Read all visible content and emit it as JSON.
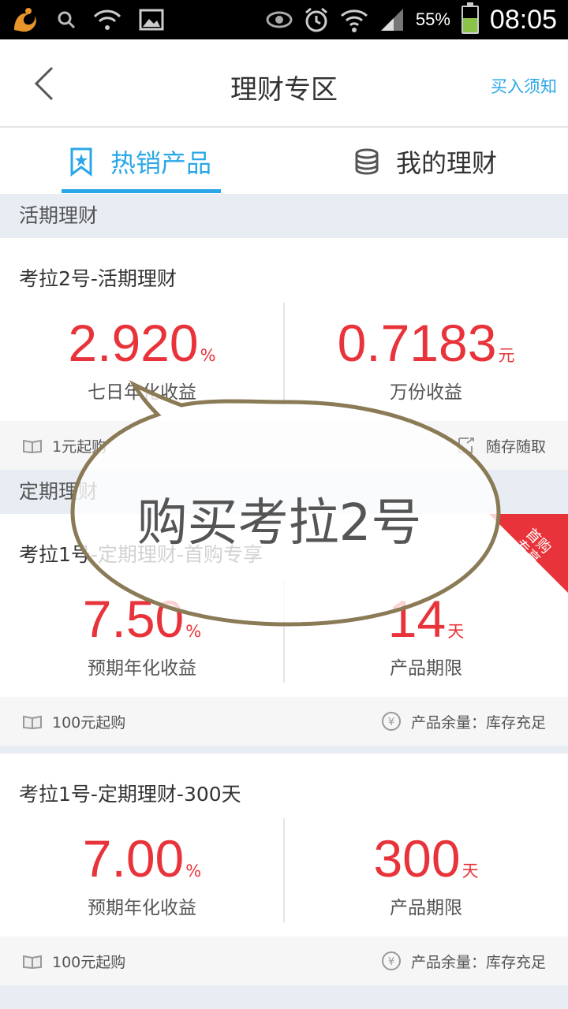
{
  "status_bar": {
    "battery_pct": "55%",
    "battery_level": 0.55,
    "time": "08:05",
    "icons": [
      "uc-browser-icon",
      "search-icon",
      "wifi-question-icon",
      "image-icon",
      "eye-icon",
      "alarm-icon",
      "wifi-icon",
      "signal-icon",
      "battery-icon"
    ]
  },
  "header": {
    "title": "理财专区",
    "notice_link": "买入须知"
  },
  "tabs": [
    {
      "label": "热销产品",
      "active": true
    },
    {
      "label": "我的理财",
      "active": false
    }
  ],
  "sections": {
    "current": "活期理财",
    "fixed": "定期理财"
  },
  "products": [
    {
      "name": "考拉2号-活期理财",
      "left_value": "2.920",
      "left_unit": "%",
      "left_label": "七日年化收益",
      "right_value": "0.7183",
      "right_unit": "元",
      "right_label": "万份收益",
      "min_buy": "1元起购",
      "right_note": "随存随取"
    },
    {
      "name": "考拉1号-定期理财-首购专享",
      "left_value": "7.50",
      "left_unit": "%",
      "left_label": "预期年化收益",
      "right_value": "14",
      "right_unit": "天",
      "right_label": "产品期限",
      "min_buy": "100元起购",
      "right_note": "产品余量：库存充足",
      "ribbon_line1": "首购",
      "ribbon_line2": "专享"
    },
    {
      "name": "考拉1号-定期理财-300天",
      "left_value": "7.00",
      "left_unit": "%",
      "left_label": "预期年化收益",
      "right_value": "300",
      "right_unit": "天",
      "right_label": "产品期限",
      "min_buy": "100元起购",
      "right_note": "产品余量：库存充足"
    }
  ],
  "overlay": {
    "bubble_text": "购买考拉2号"
  },
  "colors": {
    "accent": "#2aa7e8",
    "value_red": "#e8333a",
    "section_bg": "#e8ecf3"
  }
}
